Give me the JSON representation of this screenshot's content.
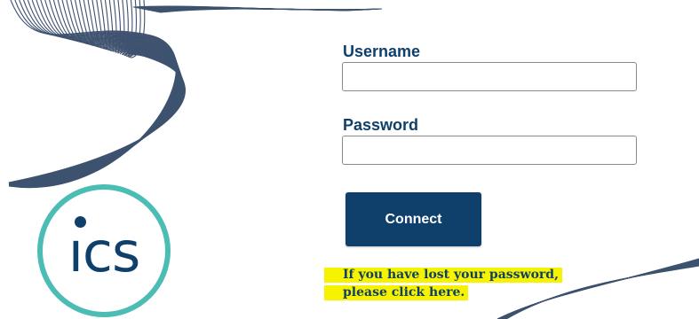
{
  "login": {
    "username_label": "Username",
    "username_value": "",
    "password_label": "Password",
    "password_value": "",
    "connect_label": "Connect",
    "lost_password_line1": "If you have lost your password,",
    "lost_password_line2": "please click here."
  },
  "logo": {
    "text": "ıcs",
    "icon": "ics-logo"
  },
  "colors": {
    "brand_navy": "#0f3f6b",
    "logo_teal": "#4bbdb4",
    "highlight": "#f7f200"
  }
}
